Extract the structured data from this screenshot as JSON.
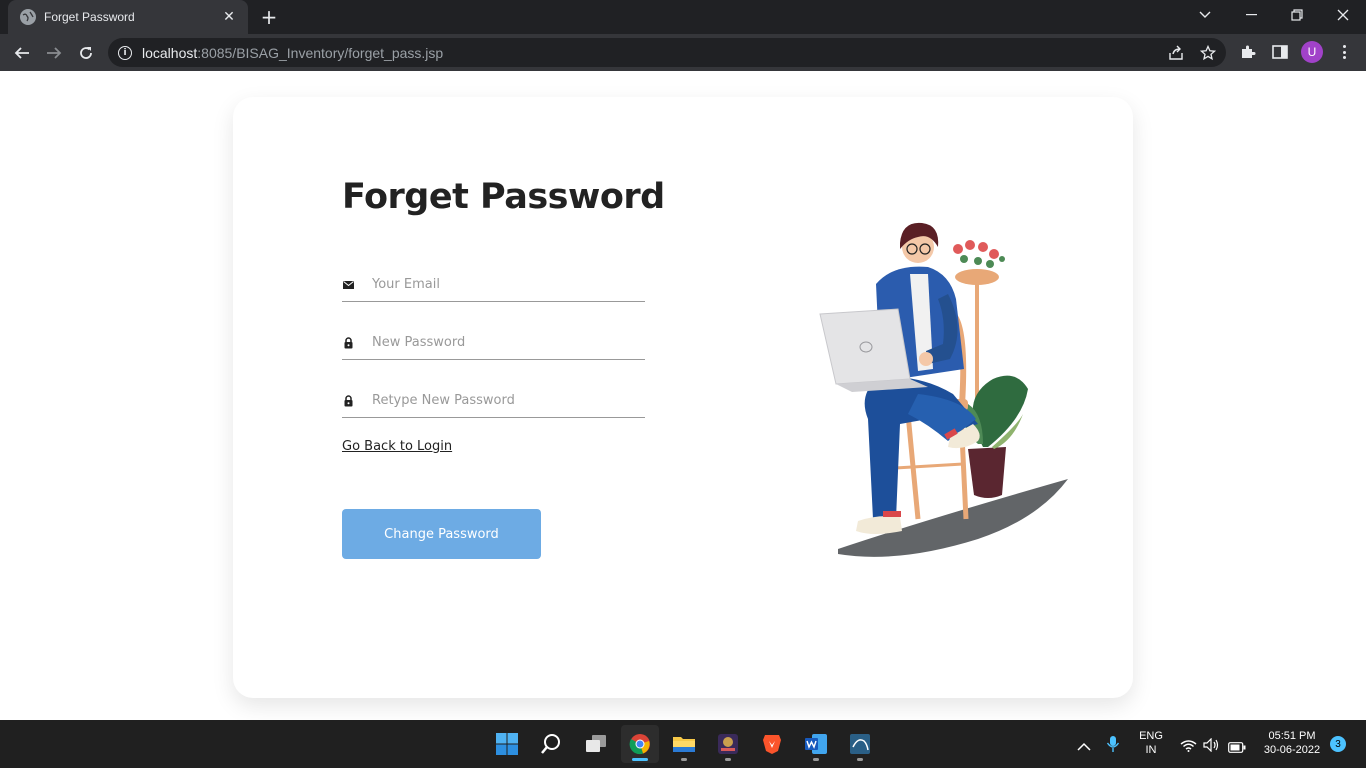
{
  "browser": {
    "tab_title": "Forget Password",
    "url_host": "localhost",
    "url_rest": ":8085/BISAG_Inventory/forget_pass.jsp",
    "profile_initial": "U"
  },
  "form": {
    "title": "Forget Password",
    "email_placeholder": "Your Email",
    "new_password_placeholder": "New Password",
    "retype_password_placeholder": "Retype New Password",
    "back_link": "Go Back to Login",
    "submit_label": "Change Password"
  },
  "taskbar": {
    "lang_line1": "ENG",
    "lang_line2": "IN",
    "time": "05:51 PM",
    "date": "30-06-2022",
    "notification_count": "3"
  },
  "colors": {
    "button": "#6dabe4",
    "chrome_dark": "#202124",
    "chrome_toolbar": "#35363a",
    "taskbar": "#202020"
  }
}
